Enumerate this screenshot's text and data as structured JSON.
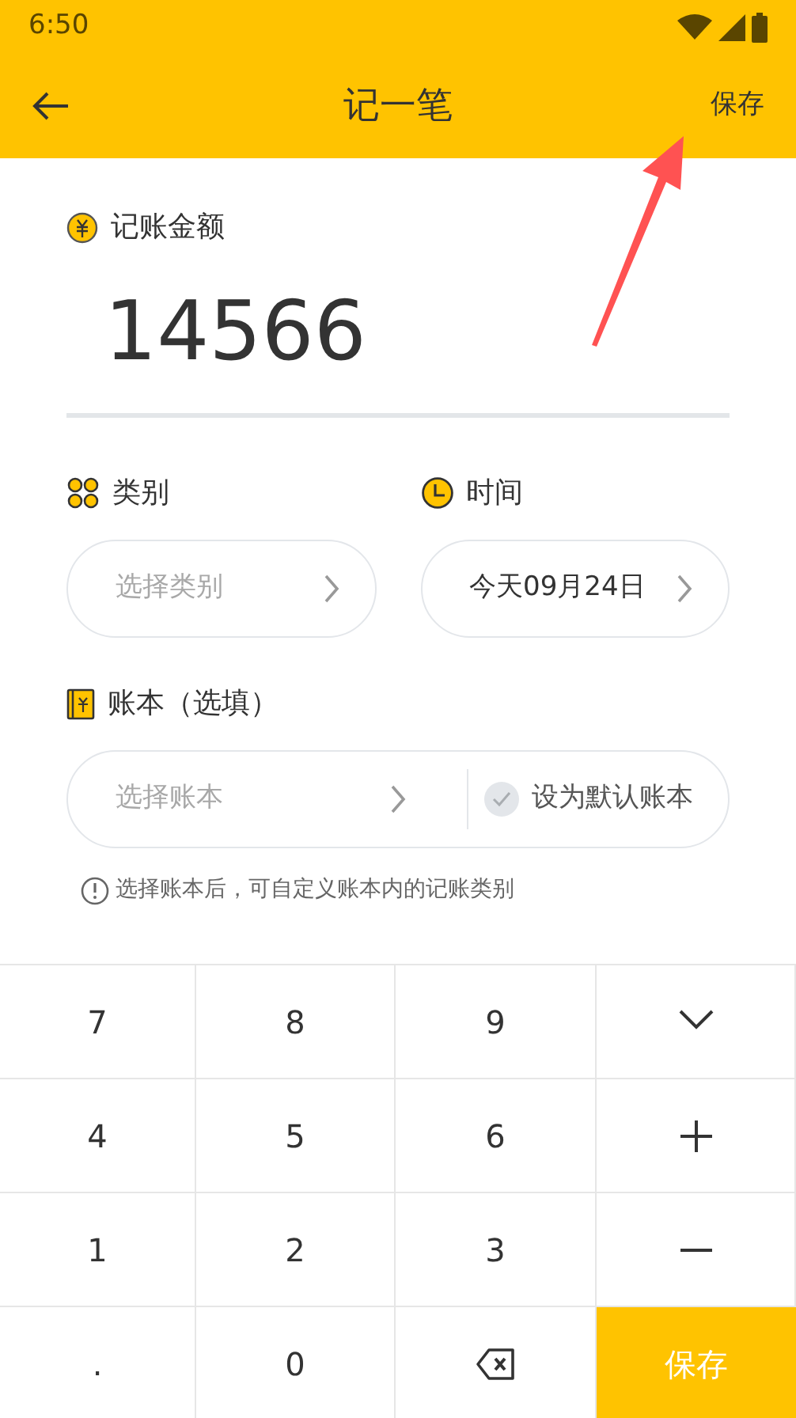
{
  "status_bar": {
    "time": "6:50"
  },
  "header": {
    "title": "记一笔",
    "action": "保存"
  },
  "amount": {
    "label": "记账金额",
    "value": "14566"
  },
  "category": {
    "label": "类别",
    "placeholder": "选择类别"
  },
  "time": {
    "label": "时间",
    "value": "今天09月24日"
  },
  "book": {
    "label": "账本（选填）",
    "placeholder": "选择账本",
    "default_label": "设为默认账本",
    "default_checked": false
  },
  "hint": "选择账本后，可自定义账本内的记账类别",
  "keypad": [
    {
      "kind": "digit",
      "label": "7"
    },
    {
      "kind": "digit",
      "label": "8"
    },
    {
      "kind": "digit",
      "label": "9"
    },
    {
      "kind": "collapse"
    },
    {
      "kind": "digit",
      "label": "4"
    },
    {
      "kind": "digit",
      "label": "5"
    },
    {
      "kind": "digit",
      "label": "6"
    },
    {
      "kind": "plus"
    },
    {
      "kind": "digit",
      "label": "1"
    },
    {
      "kind": "digit",
      "label": "2"
    },
    {
      "kind": "digit",
      "label": "3"
    },
    {
      "kind": "minus"
    },
    {
      "kind": "digit",
      "label": "."
    },
    {
      "kind": "digit",
      "label": "0"
    },
    {
      "kind": "backspace"
    },
    {
      "kind": "save",
      "label": "保存"
    }
  ]
}
